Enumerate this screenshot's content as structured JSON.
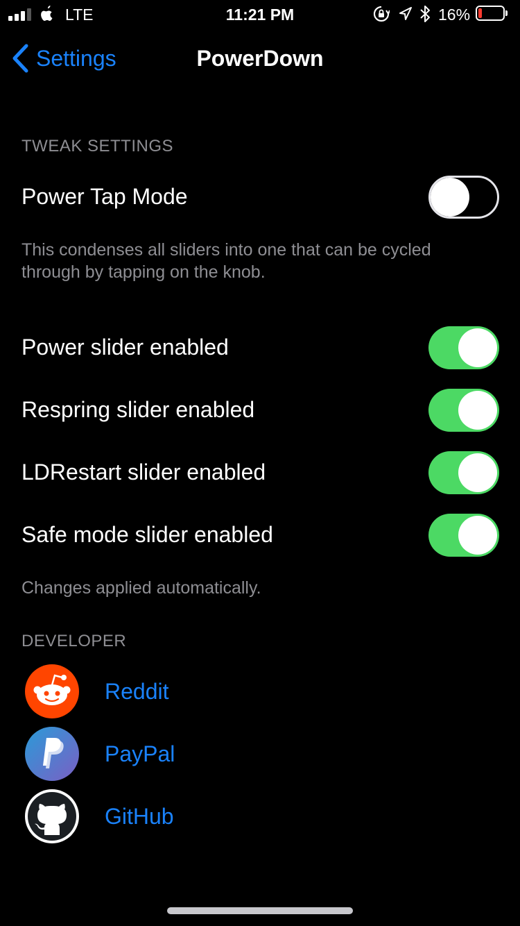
{
  "status_bar": {
    "carrier": "LTE",
    "time": "11:21 PM",
    "battery_percent": "16%",
    "battery_level": 0.16,
    "signal_bars": 3,
    "icons": [
      "signal-icon",
      "apple-logo-icon",
      "orientation-lock-icon",
      "location-icon",
      "bluetooth-icon",
      "battery-icon"
    ]
  },
  "nav": {
    "back_label": "Settings",
    "title": "PowerDown"
  },
  "tweak_settings": {
    "header": "TWEAK SETTINGS",
    "power_tap_mode": {
      "label": "Power Tap Mode",
      "on": false
    },
    "power_tap_footer": "This condenses all sliders into one that can be cycled through by tapping on the knob.",
    "toggles": [
      {
        "label": "Power slider enabled",
        "on": true
      },
      {
        "label": "Respring slider enabled",
        "on": true
      },
      {
        "label": "LDRestart slider enabled",
        "on": true
      },
      {
        "label": "Safe mode slider enabled",
        "on": true
      }
    ],
    "footer": "Changes applied automatically."
  },
  "developer": {
    "header": "DEVELOPER",
    "links": [
      {
        "label": "Reddit",
        "icon": "reddit-icon"
      },
      {
        "label": "PayPal",
        "icon": "paypal-icon"
      },
      {
        "label": "GitHub",
        "icon": "github-icon"
      }
    ]
  },
  "colors": {
    "accent": "#1a82fb",
    "toggle_on": "#4cd964",
    "reddit": "#ff4500",
    "battery_low": "#ff3b30"
  }
}
